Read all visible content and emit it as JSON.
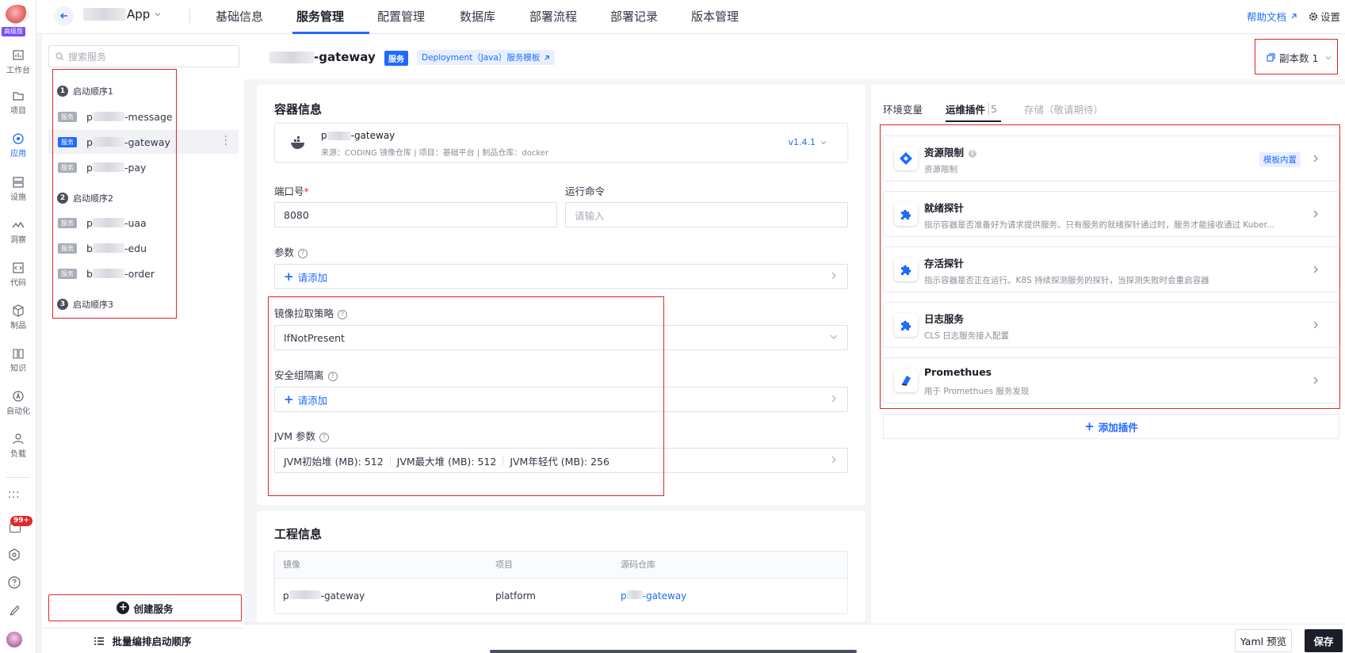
{
  "app": {
    "name_visible": "App",
    "edition_badge": "高级版"
  },
  "rail": {
    "items": [
      {
        "label": "工作台",
        "icon": "chart-icon"
      },
      {
        "label": "项目",
        "icon": "folder-icon"
      },
      {
        "label": "应用",
        "icon": "app-icon"
      },
      {
        "label": "设施",
        "icon": "server-icon"
      },
      {
        "label": "洞察",
        "icon": "pulse-icon"
      },
      {
        "label": "代码",
        "icon": "code-icon"
      },
      {
        "label": "制品",
        "icon": "box-icon"
      },
      {
        "label": "知识",
        "icon": "book-icon"
      },
      {
        "label": "自动化",
        "icon": "automation-icon"
      },
      {
        "label": "负载",
        "icon": "user-load-icon"
      }
    ],
    "notification_badge": "99+"
  },
  "topbar": {
    "tabs": [
      "基础信息",
      "服务管理",
      "配置管理",
      "数据库",
      "部署流程",
      "部署记录",
      "版本管理"
    ],
    "active_tab": "服务管理",
    "help_link": "帮助文档",
    "settings": "设置"
  },
  "service_list": {
    "search_placeholder": "搜索服务",
    "tag": "服务",
    "groups": [
      {
        "num": "1",
        "label": "启动顺序1",
        "services": [
          {
            "prefix": "p",
            "suffix": "-message",
            "selected": false
          },
          {
            "prefix": "p",
            "suffix": "-gateway",
            "selected": true
          },
          {
            "prefix": "p",
            "suffix": "-pay",
            "selected": false
          }
        ]
      },
      {
        "num": "2",
        "label": "启动顺序2",
        "services": [
          {
            "prefix": "p",
            "suffix": "-uaa",
            "selected": false
          },
          {
            "prefix": "b",
            "suffix": "-edu",
            "selected": false
          },
          {
            "prefix": "b",
            "suffix": "-order",
            "selected": false
          }
        ]
      },
      {
        "num": "3",
        "label": "启动顺序3",
        "services": []
      }
    ],
    "create_button": "创建服务",
    "batch_button": "批量编排启动顺序"
  },
  "service_header": {
    "name_suffix": "-gateway",
    "type_badge": "服务",
    "template_badge": "Deployment（Java）服务模板",
    "replicas_label": "副本数 1"
  },
  "container": {
    "section_title": "容器信息",
    "image_name_prefix": "p",
    "image_name_suffix": "-gateway",
    "image_meta": "来源：CODING 镜像仓库 | 项目：基础平台 | 制品仓库：docker",
    "version": "v1.4.1",
    "port_label": "端口号",
    "port_required": "*",
    "port_value": "8080",
    "cmd_label": "运行命令",
    "cmd_placeholder": "请输入",
    "args_label": "参数",
    "add_label": "请添加",
    "pull_policy_label": "镜像拉取策略",
    "pull_policy_value": "IfNotPresent",
    "security_label": "安全组隔离",
    "jvm_label": "JVM 参数",
    "jvm_values": [
      "JVM初始堆 (MB): 512",
      "JVM最大堆 (MB): 512",
      "JVM年轻代 (MB): 256"
    ]
  },
  "right_panel": {
    "tabs": [
      "环境变量",
      "运维插件",
      "存储（敬请期待）"
    ],
    "active_tab": "运维插件",
    "tab_count": "5",
    "plugins": [
      {
        "title": "资源限制",
        "desc": "资源限制",
        "badge": "模板内置",
        "icon": "resource-diamond-icon"
      },
      {
        "title": "就绪探针",
        "desc": "指示容器是否准备好为请求提供服务。只有服务的就绪探针通过时，服务才能接收通过 Kuber...",
        "icon": "puzzle-icon"
      },
      {
        "title": "存活探针",
        "desc": "指示容器是否正在运行。K8S 持续探测服务的探针，当探测失败时会重启容器",
        "icon": "puzzle-icon"
      },
      {
        "title": "日志服务",
        "desc": "CLS 日志服务接入配置",
        "icon": "puzzle-icon"
      },
      {
        "title": "Promethues",
        "desc": "用于 Promethues 服务发现",
        "icon": "prometheus-icon"
      }
    ],
    "add_plugin": "添加插件"
  },
  "project": {
    "section_title": "工程信息",
    "columns": [
      "镜像",
      "项目",
      "源码仓库"
    ],
    "row": {
      "image_prefix": "p",
      "image_suffix": "-gateway",
      "project": "platform",
      "repo_prefix": "p",
      "repo_suffix": "-gateway"
    }
  },
  "footer": {
    "yaml_preview": "Yaml 预览",
    "save": "保存"
  },
  "colors": {
    "accent": "#1f6bff",
    "annotation": "#e5252a",
    "dark_button": "#1b1d27"
  }
}
